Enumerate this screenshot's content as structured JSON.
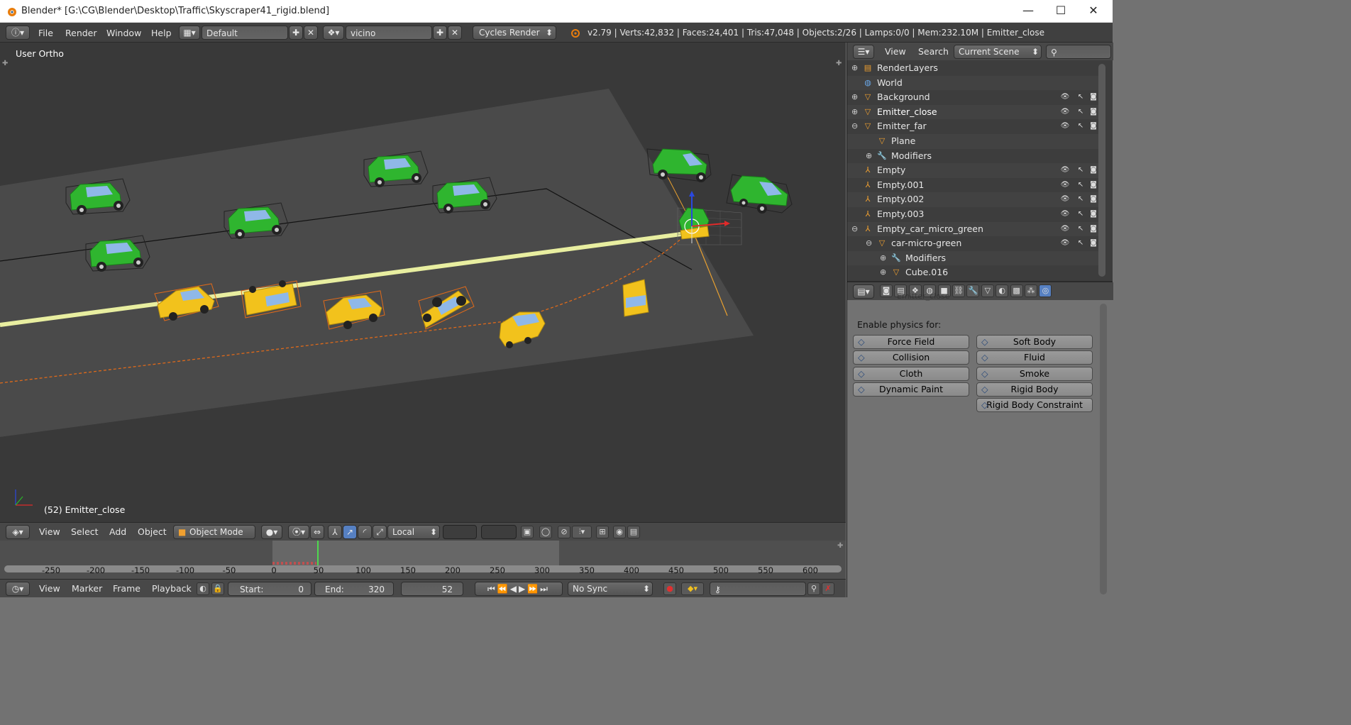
{
  "window": {
    "title": "Blender* [G:\\CG\\Blender\\Desktop\\Traffic\\Skyscraper41_rigid.blend]",
    "minimize": "—",
    "maximize": "☐",
    "close": "✕"
  },
  "info": {
    "menus": [
      "File",
      "Render",
      "Window",
      "Help"
    ],
    "layout": "Default",
    "scene": "vicino",
    "engine": "Cycles Render",
    "stats": "v2.79 | Verts:42,832 | Faces:24,401 | Tris:47,048 | Objects:2/26 | Lamps:0/0 | Mem:232.10M | Emitter_close"
  },
  "viewport": {
    "view_name": "User Ortho",
    "object_label": "(52) Emitter_close",
    "header_menus": [
      "View",
      "Select",
      "Add",
      "Object"
    ],
    "mode": "Object Mode",
    "orientation": "Local"
  },
  "timeline": {
    "ticks": [
      "-250",
      "-200",
      "-150",
      "-100",
      "-50",
      "0",
      "50",
      "100",
      "150",
      "200",
      "250",
      "300",
      "350",
      "400",
      "450",
      "500",
      "550",
      "600"
    ],
    "menus": [
      "View",
      "Marker",
      "Frame",
      "Playback"
    ],
    "start_label": "Start:",
    "start_value": "0",
    "end_label": "End:",
    "end_value": "320",
    "current_frame": "52",
    "sync": "No Sync"
  },
  "outliner": {
    "menus": [
      "View",
      "Search"
    ],
    "display": "Current Scene",
    "rows": [
      {
        "label": "RenderLayers",
        "indent": 0,
        "icon": "render-layers-icon",
        "glyph": "▤",
        "expand": "+",
        "vis": false
      },
      {
        "label": "World",
        "indent": 0,
        "icon": "world-icon",
        "glyph": "◍",
        "expand": "",
        "vis": false
      },
      {
        "label": "Background",
        "indent": 0,
        "icon": "mesh-object-icon",
        "glyph": "▽",
        "expand": "+",
        "vis": true
      },
      {
        "label": "Emitter_close",
        "indent": 0,
        "icon": "mesh-object-icon",
        "glyph": "▽",
        "expand": "+",
        "vis": true,
        "selected": true
      },
      {
        "label": "Emitter_far",
        "indent": 0,
        "icon": "mesh-object-icon",
        "glyph": "▽",
        "expand": "−",
        "vis": true
      },
      {
        "label": "Plane",
        "indent": 1,
        "icon": "mesh-data-icon",
        "glyph": "▽",
        "expand": "",
        "vis": false
      },
      {
        "label": "Modifiers",
        "indent": 1,
        "icon": "wrench-icon",
        "glyph": "🔧",
        "expand": "+",
        "vis": false
      },
      {
        "label": "Empty",
        "indent": 0,
        "icon": "empty-icon",
        "glyph": "⅄",
        "expand": "",
        "vis": true
      },
      {
        "label": "Empty.001",
        "indent": 0,
        "icon": "empty-icon",
        "glyph": "⅄",
        "expand": "",
        "vis": true
      },
      {
        "label": "Empty.002",
        "indent": 0,
        "icon": "empty-icon",
        "glyph": "⅄",
        "expand": "",
        "vis": true
      },
      {
        "label": "Empty.003",
        "indent": 0,
        "icon": "empty-icon",
        "glyph": "⅄",
        "expand": "",
        "vis": true
      },
      {
        "label": "Empty_car_micro_green",
        "indent": 0,
        "icon": "empty-icon",
        "glyph": "⅄",
        "expand": "−",
        "vis": true
      },
      {
        "label": "car-micro-green",
        "indent": 1,
        "icon": "mesh-object-icon",
        "glyph": "▽",
        "expand": "−",
        "vis": true
      },
      {
        "label": "Modifiers",
        "indent": 2,
        "icon": "wrench-icon",
        "glyph": "🔧",
        "expand": "+",
        "vis": false
      },
      {
        "label": "Cube.016",
        "indent": 2,
        "icon": "mesh-data-icon",
        "glyph": "▽",
        "expand": "+",
        "vis": false
      }
    ]
  },
  "properties": {
    "context_label": "Emitter_close",
    "enable_label": "Enable physics for:",
    "left_buttons": [
      "Force Field",
      "Collision",
      "Cloth",
      "Dynamic Paint"
    ],
    "right_buttons": [
      "Soft Body",
      "Fluid",
      "Smoke",
      "Rigid Body",
      "Rigid Body Constraint"
    ]
  },
  "colors": {
    "accent": "#5680c2",
    "car_green": "#2fb52f",
    "car_yellow": "#f2c21c",
    "path_orange": "#e06a1a",
    "road_line": "#e8eea0"
  }
}
